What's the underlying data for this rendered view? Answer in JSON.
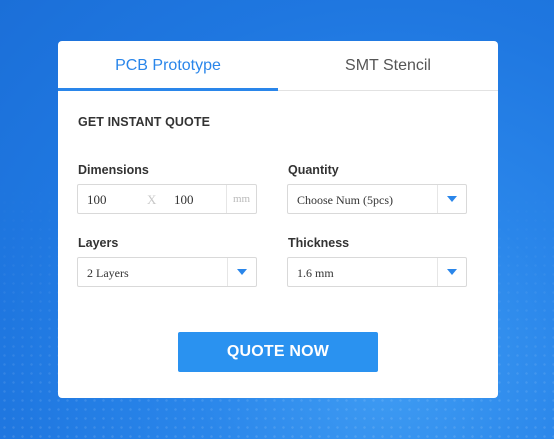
{
  "tabs": [
    {
      "label": "PCB Prototype",
      "active": true
    },
    {
      "label": "SMT Stencil",
      "active": false
    }
  ],
  "heading": "GET INSTANT QUOTE",
  "fields": {
    "dimensions": {
      "label": "Dimensions",
      "width": "100",
      "separator": "X",
      "height": "100",
      "unit": "mm"
    },
    "quantity": {
      "label": "Quantity",
      "value": "Choose Num (5pcs)"
    },
    "layers": {
      "label": "Layers",
      "value": "2 Layers"
    },
    "thickness": {
      "label": "Thickness",
      "value": "1.6 mm"
    }
  },
  "button": {
    "label": "QUOTE NOW"
  },
  "colors": {
    "accent": "#2a86ea",
    "background": "#1f77e0",
    "button": "#2a92f0"
  }
}
